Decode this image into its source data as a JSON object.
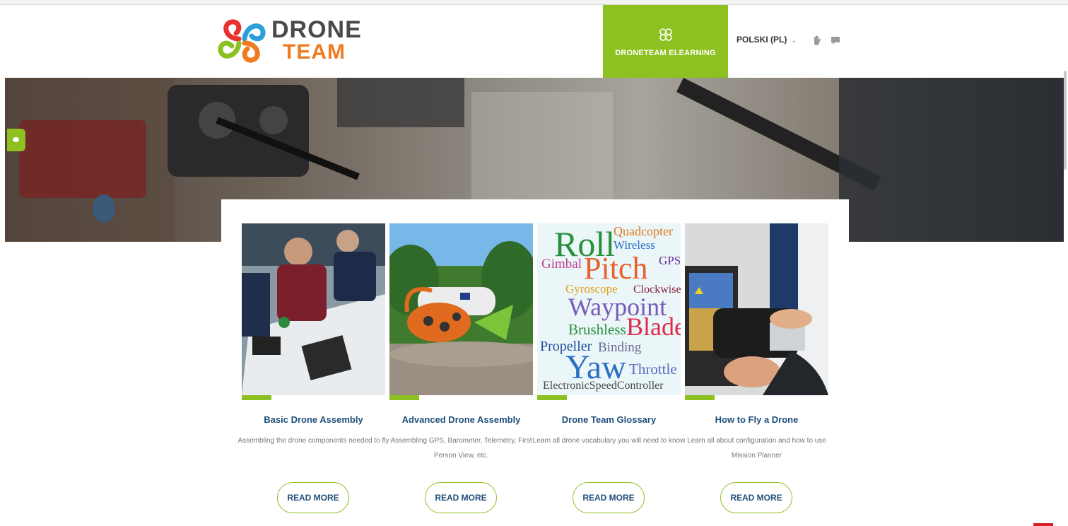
{
  "header": {
    "logo": {
      "line1": "DRONE",
      "line2": "TEAM"
    },
    "elearning_label": "DRONETEAM ELEARNING",
    "language": "POLSKI (PL)",
    "icons": [
      "drone-logo-icon",
      "hand-icon",
      "chat-icon",
      "chevron-down-icon"
    ]
  },
  "colors": {
    "accent_green": "#8dc021",
    "title_blue": "#1e4f7a",
    "brand_orange": "#f07a22",
    "red_corner": "#d71f26"
  },
  "cards": [
    {
      "title": "Basic Drone Assembly",
      "desc": "Assembling the drone components needed to fly",
      "button": "READ MORE"
    },
    {
      "title": "Advanced Drone Assembly",
      "desc": "Assembling GPS, Barometer, Telemetry, First Person View, etc.",
      "button": "READ MORE"
    },
    {
      "title": "Drone Team Glossary",
      "desc": "Learn all drone vocabulary you will need to know",
      "button": "READ MORE"
    },
    {
      "title": "How to Fly a Drone",
      "desc": "Learn all about configuration and how to use Mission Planner",
      "button": "READ MORE"
    }
  ],
  "glossary_cloud": {
    "words": [
      "Roll",
      "Quadcopter",
      "Wireless",
      "Gimbal",
      "Pitch",
      "GPS",
      "Gyroscope",
      "Clockwise",
      "Waypoint",
      "Brushless",
      "Blade",
      "Propeller",
      "Binding",
      "Yaw",
      "Throttle",
      "ElectronicSpeedController"
    ]
  }
}
